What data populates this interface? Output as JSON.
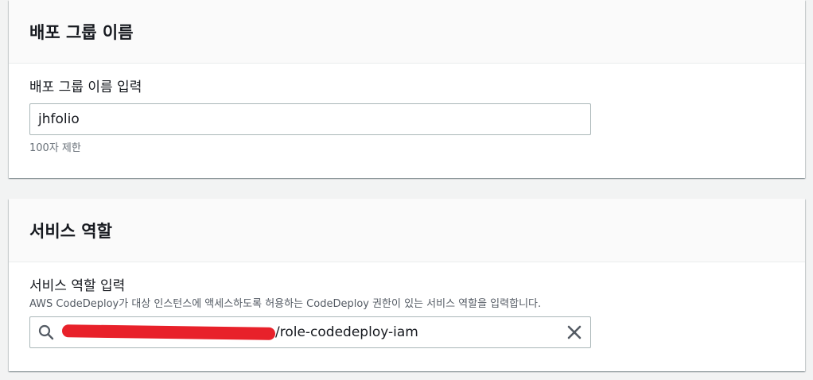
{
  "deployment_group": {
    "title": "배포 그룹 이름",
    "field_label": "배포 그룹 이름 입력",
    "input_value": "jhfolio",
    "constraint": "100자 제한"
  },
  "service_role": {
    "title": "서비스 역할",
    "field_label": "서비스 역할 입력",
    "description": "AWS CodeDeploy가 대상 인스턴스에 액세스하도록 허용하는 CodeDeploy 권한이 있는 서비스 역할을 입력합니다.",
    "input_value_visible": "/role-codedeploy-iam",
    "icons": {
      "search": "search-icon",
      "clear": "close-icon"
    }
  },
  "colors": {
    "redaction": "#e8212a",
    "panel_header_bg": "#fafafa",
    "page_bg": "#f2f3f3"
  }
}
